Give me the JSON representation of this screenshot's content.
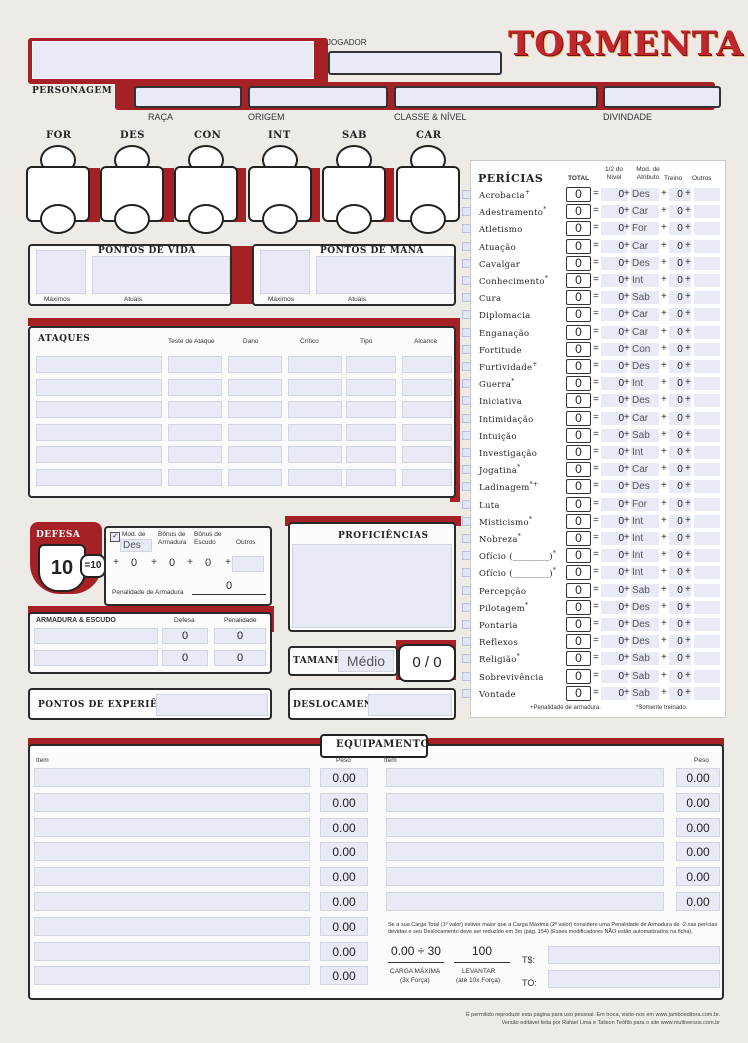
{
  "logo": "TORMENTA",
  "header": {
    "personagem": "PERSONAGEM",
    "jogador": "JOGADOR",
    "raca": "RAÇA",
    "origem": "ORIGEM",
    "classe": "CLASSE & NÍVEL",
    "divindade": "DIVINDADE"
  },
  "attributes": [
    "FOR",
    "DES",
    "CON",
    "INT",
    "SAB",
    "CAR"
  ],
  "vida": {
    "title": "PONTOS DE VIDA",
    "max": "Máximos",
    "cur": "Atuais"
  },
  "mana": {
    "title": "PONTOS DE MANA",
    "max": "Máximos",
    "cur": "Atuais"
  },
  "ataques": {
    "title": "ATAQUES",
    "cols": [
      "Teste de Ataque",
      "Dano",
      "Crítico",
      "Tipo",
      "Alcance"
    ]
  },
  "defesa": {
    "title": "DEFESA",
    "value": "10",
    "eq": "=10",
    "mod_label": "Mod. de",
    "mod_attr": "Des",
    "bonus_arm": "Bônus de Armadura",
    "bonus_esc": "Bônus de Escudo",
    "outros": "Outros",
    "zeros": [
      "0",
      "0",
      "0",
      "0"
    ],
    "penalidade_label": "Penalidade de Armadura",
    "penalidade": "0"
  },
  "armadura": {
    "title": "ARMADURA & ESCUDO",
    "defesa": "Defesa",
    "penalidade": "Penalidade",
    "rows": [
      [
        "0",
        "0"
      ],
      [
        "0",
        "0"
      ]
    ]
  },
  "proficiencias": {
    "title": "PROFICIÊNCIAS"
  },
  "tamanho": {
    "title": "TAMANHO",
    "value": "Médio",
    "ratio": "0 / 0"
  },
  "xp": {
    "title": "PONTOS DE EXPERIÊNCIA"
  },
  "deslocamento": {
    "title": "DESLOCAMENTO"
  },
  "pericias": {
    "title": "PERÍCIAS",
    "col_total": "TOTAL",
    "col_half": "1/2 do Nível",
    "col_mod": "Mod. de Atributo",
    "col_treino": "Treino",
    "col_outros": "Outros",
    "rows": [
      {
        "name": "Acrobacia",
        "mark": "+",
        "total": "0",
        "half": "0",
        "attr": "Des",
        "train": "0"
      },
      {
        "name": "Adestramento",
        "mark": "*",
        "total": "0",
        "half": "0",
        "attr": "Car",
        "train": "0"
      },
      {
        "name": "Atletismo",
        "mark": "",
        "total": "0",
        "half": "0",
        "attr": "For",
        "train": "0"
      },
      {
        "name": "Atuação",
        "mark": "",
        "total": "0",
        "half": "0",
        "attr": "Car",
        "train": "0"
      },
      {
        "name": "Cavalgar",
        "mark": "",
        "total": "0",
        "half": "0",
        "attr": "Des",
        "train": "0"
      },
      {
        "name": "Conhecimento",
        "mark": "*",
        "total": "0",
        "half": "0",
        "attr": "Int",
        "train": "0"
      },
      {
        "name": "Cura",
        "mark": "",
        "total": "0",
        "half": "0",
        "attr": "Sab",
        "train": "0"
      },
      {
        "name": "Diplomacia",
        "mark": "",
        "total": "0",
        "half": "0",
        "attr": "Car",
        "train": "0"
      },
      {
        "name": "Enganação",
        "mark": "",
        "total": "0",
        "half": "0",
        "attr": "Car",
        "train": "0"
      },
      {
        "name": "Fortitude",
        "mark": "",
        "total": "0",
        "half": "0",
        "attr": "Con",
        "train": "0"
      },
      {
        "name": "Furtividade",
        "mark": "+",
        "total": "0",
        "half": "0",
        "attr": "Des",
        "train": "0"
      },
      {
        "name": "Guerra",
        "mark": "*",
        "total": "0",
        "half": "0",
        "attr": "Int",
        "train": "0"
      },
      {
        "name": "Iniciativa",
        "mark": "",
        "total": "0",
        "half": "0",
        "attr": "Des",
        "train": "0"
      },
      {
        "name": "Intimidação",
        "mark": "",
        "total": "0",
        "half": "0",
        "attr": "Car",
        "train": "0"
      },
      {
        "name": "Intuição",
        "mark": "",
        "total": "0",
        "half": "0",
        "attr": "Sab",
        "train": "0"
      },
      {
        "name": "Investigação",
        "mark": "",
        "total": "0",
        "half": "0",
        "attr": "Int",
        "train": "0"
      },
      {
        "name": "Jogatina",
        "mark": "*",
        "total": "0",
        "half": "0",
        "attr": "Car",
        "train": "0"
      },
      {
        "name": "Ladinagem",
        "mark": "*+",
        "total": "0",
        "half": "0",
        "attr": "Des",
        "train": "0"
      },
      {
        "name": "Luta",
        "mark": "",
        "total": "0",
        "half": "0",
        "attr": "For",
        "train": "0"
      },
      {
        "name": "Misticismo",
        "mark": "*",
        "total": "0",
        "half": "0",
        "attr": "Int",
        "train": "0"
      },
      {
        "name": "Nobreza",
        "mark": "*",
        "total": "0",
        "half": "0",
        "attr": "Int",
        "train": "0"
      },
      {
        "name": "Ofício (________)",
        "mark": "*",
        "total": "0",
        "half": "0",
        "attr": "Int",
        "train": "0"
      },
      {
        "name": "Ofício (________)",
        "mark": "*",
        "total": "0",
        "half": "0",
        "attr": "Int",
        "train": "0"
      },
      {
        "name": "Percepção",
        "mark": "",
        "total": "0",
        "half": "0",
        "attr": "Sab",
        "train": "0"
      },
      {
        "name": "Pilotagem",
        "mark": "*",
        "total": "0",
        "half": "0",
        "attr": "Des",
        "train": "0"
      },
      {
        "name": "Pontaria",
        "mark": "",
        "total": "0",
        "half": "0",
        "attr": "Des",
        "train": "0"
      },
      {
        "name": "Reflexos",
        "mark": "",
        "total": "0",
        "half": "0",
        "attr": "Des",
        "train": "0"
      },
      {
        "name": "Religião",
        "mark": "*",
        "total": "0",
        "half": "0",
        "attr": "Sab",
        "train": "0"
      },
      {
        "name": "Sobrevivência",
        "mark": "",
        "total": "0",
        "half": "0",
        "attr": "Sab",
        "train": "0"
      },
      {
        "name": "Vontade",
        "mark": "",
        "total": "0",
        "half": "0",
        "attr": "Sab",
        "train": "0"
      }
    ],
    "footnote1": "+Penalidade de armadura.",
    "footnote2": "*Somente treinado."
  },
  "equipamento": {
    "title": "EQUIPAMENTO",
    "item": "Item",
    "peso": "Peso",
    "left_weights": [
      "0.00",
      "0.00",
      "0.00",
      "0.00",
      "0.00",
      "0.00",
      "0.00",
      "0.00",
      "0.00"
    ],
    "right_weights": [
      "0.00",
      "0.00",
      "0.00",
      "0.00",
      "0.00",
      "0.00"
    ],
    "note": "Se a sua Carga Total (1º valor) estiver maior que a Carga Máxima (2º valor) considere uma Penalidade de Armadura de -2 nas perícias devidas e seu Deslocamento deve ser reduzido em 3m (pág. 154) (Esses modificadores NÃO estão automatizados na ficha).",
    "carga": "0.00 ÷ 30",
    "carga_label": "CARGA MÁXIMA",
    "carga_sub": "(3x Força)",
    "levantar": "100",
    "levantar_label": "LEVANTAR",
    "levantar_sub": "(até 10x Força)",
    "ts": "T$:",
    "to": "TO:"
  },
  "footer": {
    "line1": "É permitido reproduzir esta página para uso pessoal. Em troca, visite-nos em www.jamboeditora.com.br.",
    "line2": "Versão editável feita por Rafael Lima e Talison Teófilo para o site www.multiversos.com.br"
  },
  "colors": {
    "accent": "#a52125",
    "field": "#e8ebf6"
  }
}
